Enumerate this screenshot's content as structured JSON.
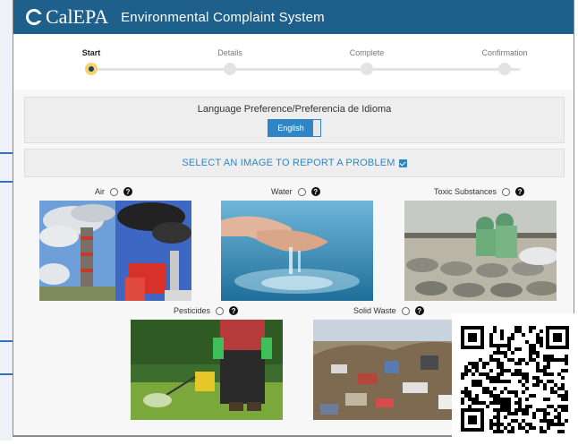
{
  "header": {
    "logo_text": "CalEPA",
    "app_title": "Environmental Complaint System"
  },
  "progress": {
    "steps": [
      {
        "label": "Start",
        "active": true
      },
      {
        "label": "Details",
        "active": false
      },
      {
        "label": "Complete",
        "active": false
      },
      {
        "label": "Confirmation",
        "active": false
      }
    ]
  },
  "language": {
    "label": "Language Preference/Preferencia de Idioma",
    "selected": "English"
  },
  "select_prompt": "SELECT AN IMAGE TO REPORT A PROBLEM",
  "categories": [
    {
      "label": "Air",
      "help": "?"
    },
    {
      "label": "Water",
      "help": "?"
    },
    {
      "label": "Toxic Substances",
      "help": "?"
    },
    {
      "label": "Pesticides",
      "help": "?"
    },
    {
      "label": "Solid Waste",
      "help": "?"
    }
  ],
  "colors": {
    "header_bg": "#1e5f8c",
    "accent": "#2f86c6",
    "active_step": "#f3d36a"
  },
  "icons": [
    "calepa-logo-icon",
    "checkbox-checked-icon",
    "radio-icon",
    "help-icon",
    "qr-code-icon"
  ]
}
